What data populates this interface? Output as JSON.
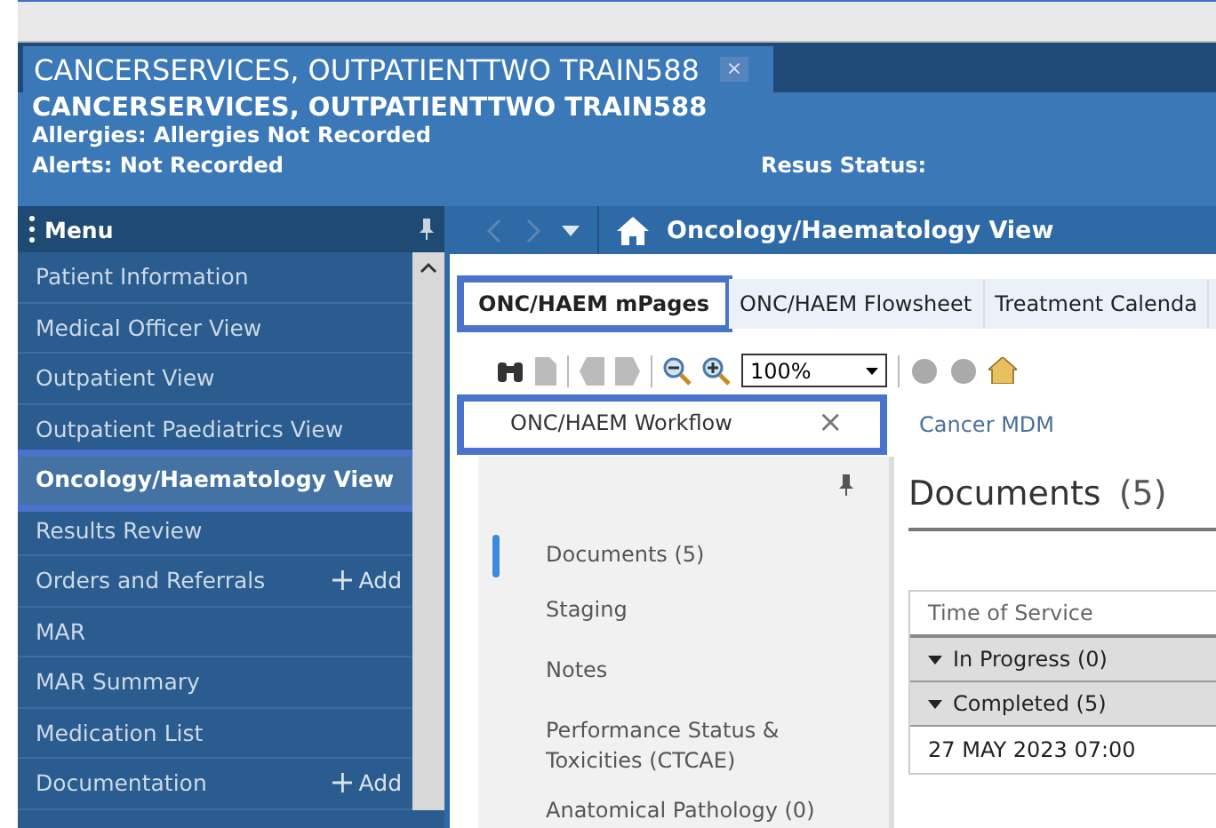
{
  "patient_tab": {
    "title": "CANCERSERVICES, OUTPATIENTTWO TRAIN588",
    "close": "×"
  },
  "banner": {
    "name": "CANCERSERVICES, OUTPATIENTTWO TRAIN588",
    "allergies": "Allergies: Allergies Not Recorded",
    "alerts": "Alerts: Not Recorded",
    "resus": "Resus Status:"
  },
  "menu": {
    "title": "Menu",
    "items": [
      {
        "label": "Patient Information",
        "selected": false
      },
      {
        "label": "Medical Officer View",
        "selected": false
      },
      {
        "label": "Outpatient View",
        "selected": false
      },
      {
        "label": "Outpatient Paediatrics View",
        "selected": false
      },
      {
        "label": "Oncology/Haematology View",
        "selected": true
      },
      {
        "label": "Results Review",
        "selected": false
      },
      {
        "label": "Orders and Referrals",
        "selected": false,
        "add": "Add"
      },
      {
        "label": "MAR",
        "selected": false
      },
      {
        "label": "MAR Summary",
        "selected": false
      },
      {
        "label": "Medication List",
        "selected": false
      },
      {
        "label": "Documentation",
        "selected": false,
        "add": "Add"
      }
    ]
  },
  "view_title": "Oncology/Haematology View",
  "tabs": [
    {
      "label": "ONC/HAEM mPages",
      "selected": true
    },
    {
      "label": "ONC/HAEM Flowsheet",
      "selected": false
    },
    {
      "label": "Treatment Calenda",
      "selected": false
    }
  ],
  "zoom": {
    "value": "100%"
  },
  "page_tabs": [
    {
      "label": "ONC/HAEM Workflow",
      "selected": true,
      "close": "×"
    },
    {
      "label": "Cancer MDM",
      "selected": false
    }
  ],
  "sections": [
    {
      "label": "Documents (5)",
      "selected": true
    },
    {
      "label": "Staging",
      "selected": false
    },
    {
      "label": "Notes",
      "selected": false
    },
    {
      "label": "Performance Status & Toxicities (CTCAE)",
      "selected": false
    },
    {
      "label": "Anatomical Pathology (0)",
      "selected": false
    }
  ],
  "documents": {
    "title": "Documents",
    "count": "(5)",
    "column": "Time of Service",
    "groups": [
      "In Progress (0)",
      "Completed (5)"
    ],
    "rows": [
      "27 MAY 2023 07:00"
    ]
  }
}
